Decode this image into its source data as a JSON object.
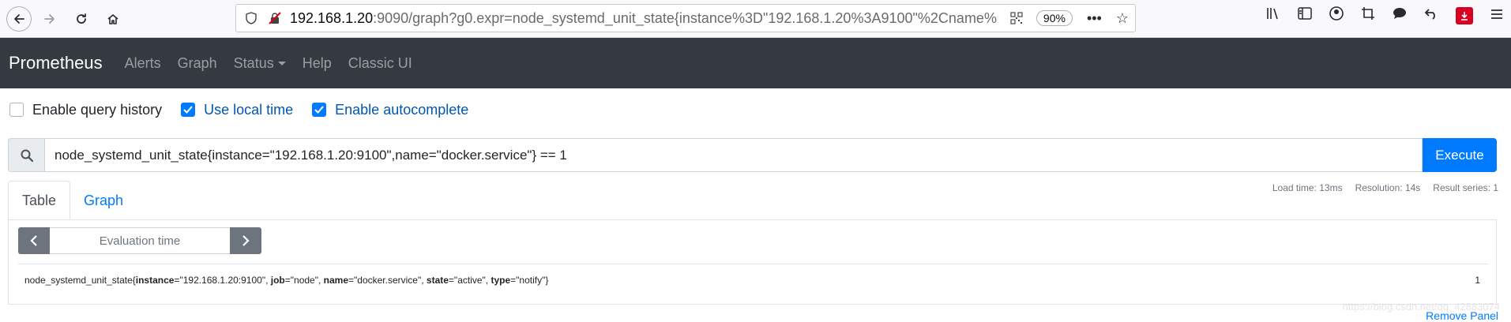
{
  "browser": {
    "url_host": "192.168.1.20",
    "url_rest": ":9090/graph?g0.expr=node_systemd_unit_state{instance%3D\"192.168.1.20%3A9100\"%2Cname%",
    "zoom": "90%"
  },
  "navbar": {
    "brand": "Prometheus",
    "links": [
      "Alerts",
      "Graph",
      "Status",
      "Help",
      "Classic UI"
    ]
  },
  "options": {
    "query_history": "Enable query history",
    "local_time": "Use local time",
    "autocomplete": "Enable autocomplete"
  },
  "query": {
    "expression": "node_systemd_unit_state{instance=\"192.168.1.20:9100\",name=\"docker.service\"} == 1",
    "execute_label": "Execute"
  },
  "panel": {
    "tabs": [
      "Table",
      "Graph"
    ],
    "load_time": "Load time: 13ms",
    "resolution": "Resolution: 14s",
    "result_series": "Result series: 1",
    "eval_placeholder": "Evaluation time",
    "result": {
      "metric": "node_systemd_unit_state{",
      "labels": [
        {
          "key": "instance",
          "value": "=\"192.168.1.20:9100\", "
        },
        {
          "key": "job",
          "value": "=\"node\", "
        },
        {
          "key": "name",
          "value": "=\"docker.service\", "
        },
        {
          "key": "state",
          "value": "=\"active\", "
        },
        {
          "key": "type",
          "value": "=\"notify\"}"
        }
      ],
      "value": "1"
    },
    "remove_label": "Remove Panel"
  },
  "watermark": "https://blog.csdn.net/qq_42883074",
  "colors": {
    "navbar": "#343a40",
    "primary": "#007bff",
    "secondary": "#6c757d"
  }
}
